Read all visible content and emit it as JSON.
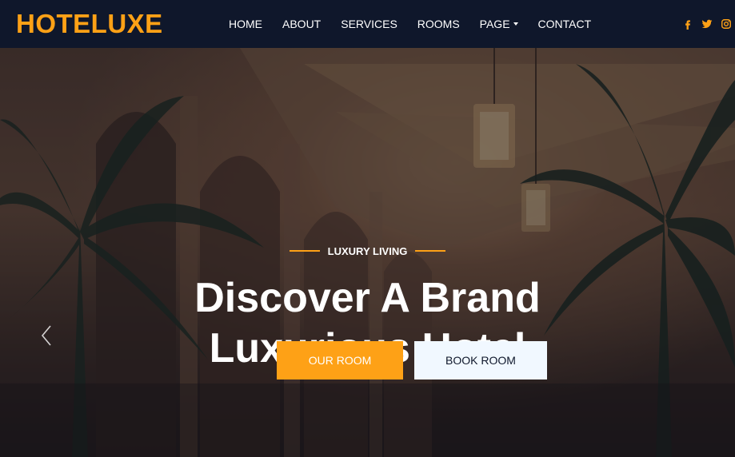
{
  "brand": {
    "name": "HOTELUXE"
  },
  "nav": {
    "items": [
      {
        "label": "HOME"
      },
      {
        "label": "ABOUT"
      },
      {
        "label": "SERVICES"
      },
      {
        "label": "ROOMS"
      },
      {
        "label": "PAGE"
      },
      {
        "label": "CONTACT"
      }
    ]
  },
  "social": {
    "icons": [
      "facebook-icon",
      "twitter-icon",
      "instagram-icon"
    ]
  },
  "hero": {
    "eyebrow": "LUXURY LIVING",
    "headline_line1": "Discover A Brand",
    "headline_line2": "Luxurious Hotel",
    "primary_button": "OUR ROOM",
    "secondary_button": "BOOK ROOM"
  },
  "colors": {
    "accent": "#fea116",
    "navbar_bg": "#0f172b",
    "light_button_bg": "#f1f8ff"
  }
}
